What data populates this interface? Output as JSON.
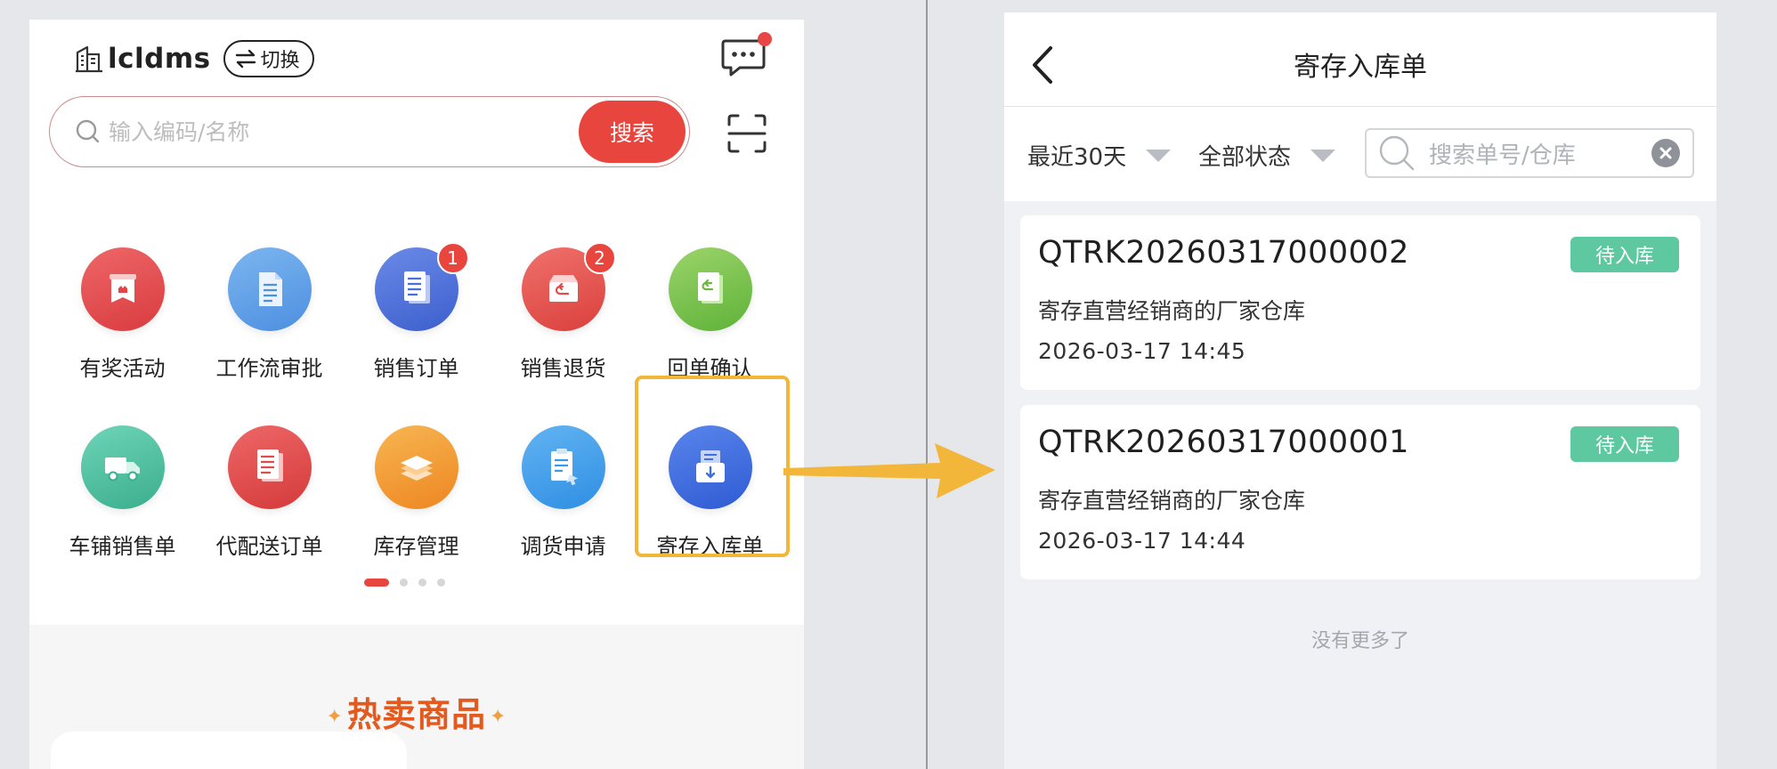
{
  "home": {
    "company_name": "lcldms",
    "switch_label": "切换",
    "search_placeholder": "输入编码/名称",
    "search_button": "搜索",
    "menu_items": [
      {
        "label": "有奖活动",
        "color": "#e84d50",
        "icon": "gift-icon",
        "badge": ""
      },
      {
        "label": "工作流审批",
        "color": "#5a9be8",
        "icon": "document-icon",
        "badge": ""
      },
      {
        "label": "销售订单",
        "color": "#4a6fd8",
        "icon": "order-list-icon",
        "badge": "1"
      },
      {
        "label": "销售退货",
        "color": "#e9534f",
        "icon": "return-box-icon",
        "badge": "2"
      },
      {
        "label": "回单确认",
        "color": "#7cc24a",
        "icon": "receipt-return-icon",
        "badge": ""
      },
      {
        "label": "车铺销售单",
        "color": "#4fc0a0",
        "icon": "truck-icon",
        "badge": ""
      },
      {
        "label": "代配送订单",
        "color": "#e24b4b",
        "icon": "delivery-doc-icon",
        "badge": ""
      },
      {
        "label": "库存管理",
        "color": "#f39a2e",
        "icon": "layers-icon",
        "badge": ""
      },
      {
        "label": "调货申请",
        "color": "#3a9ae8",
        "icon": "transfer-doc-icon",
        "badge": ""
      },
      {
        "label": "寄存入库单",
        "color": "#3d6fe0",
        "icon": "inbound-box-icon",
        "badge": ""
      }
    ],
    "hot_title": "热卖商品"
  },
  "detail": {
    "nav_title": "寄存入库单",
    "filter_date": "最近30天",
    "filter_status": "全部状态",
    "search_placeholder": "搜索单号/仓库",
    "orders": [
      {
        "order_no": "QTRK20260317000002",
        "status": "待入库",
        "warehouse": "寄存直营经销商的厂家仓库",
        "time": "2026-03-17 14:45"
      },
      {
        "order_no": "QTRK20260317000001",
        "status": "待入库",
        "warehouse": "寄存直营经销商的厂家仓库",
        "time": "2026-03-17 14:44"
      }
    ],
    "no_more": "没有更多了"
  },
  "colors": {
    "brand_red": "#e8453e",
    "highlight_yellow": "#f2b63a",
    "status_green": "#5ec8a0"
  }
}
